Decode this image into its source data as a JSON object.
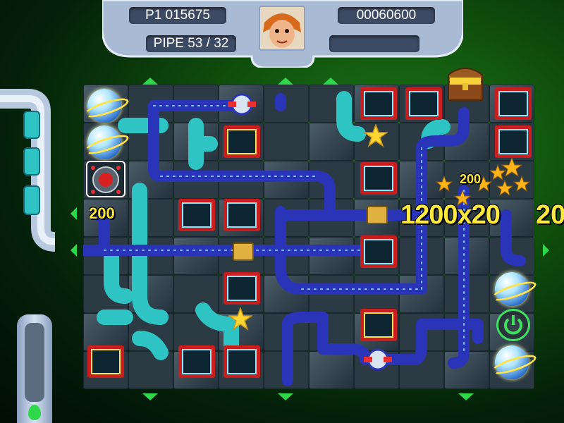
{
  "hud": {
    "player_score": "P1 015675",
    "pipe_counter": "PIPE 53 / 32",
    "total_score": "00060600",
    "blank_display": ""
  },
  "popups": {
    "small_points": "200",
    "combo_points": "1200x20",
    "combo_cut": "20",
    "floating_points": "200"
  },
  "colors": {
    "pipe_blue": "#2a34b8",
    "pipe_teal": "#2ec4c4",
    "chip_red": "#c81e1e",
    "highlight_green": "#2fd84a",
    "points_yellow": "#ffe93a"
  },
  "icons": [
    "planet-orb-icon",
    "bomb-icon",
    "star-icon",
    "microchip-icon",
    "treasure-chest-icon",
    "power-button-icon",
    "water-drop-icon",
    "avatar-face-icon"
  ]
}
